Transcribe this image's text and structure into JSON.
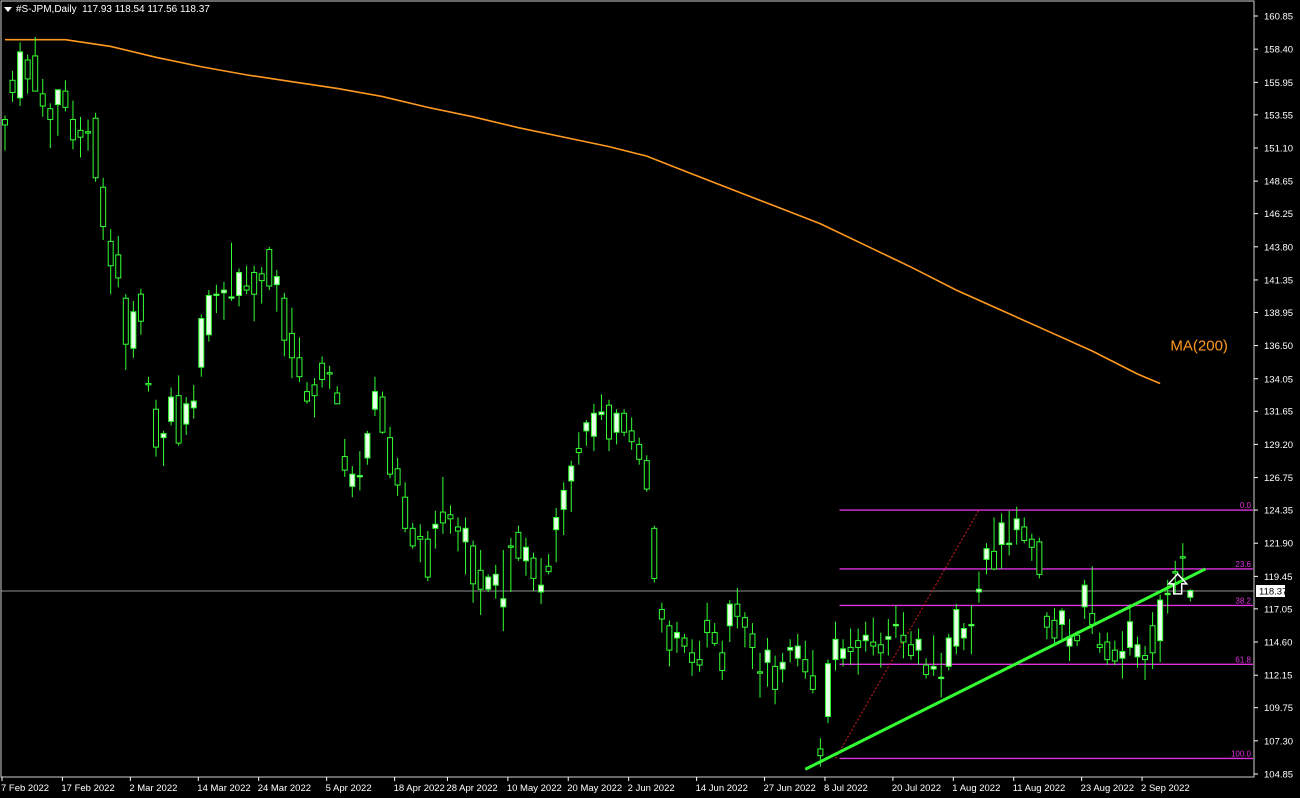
{
  "header": {
    "symbol": "#S-JPM,Daily",
    "ohlc": "117.93 118.54 117.56 118.37"
  },
  "colors": {
    "background": "#000000",
    "candle_up": "#e8ffe8",
    "candle_down": "#000000",
    "wick": "#33ff33",
    "ma": "#ff9a1e",
    "fib": "#e030e0",
    "trendline": "#33ff33",
    "price_line": "#c0c0c0",
    "axis": "#ffffff",
    "arrow": "#ffffff"
  },
  "chart_data": {
    "type": "candlestick",
    "symbol": "#S-JPM",
    "timeframe": "Daily",
    "ylim": [
      104.85,
      160.85
    ],
    "y_ticks": [
      "160.85",
      "158.40",
      "155.95",
      "153.55",
      "151.10",
      "148.65",
      "146.25",
      "143.80",
      "141.35",
      "138.95",
      "136.50",
      "134.05",
      "131.65",
      "129.20",
      "126.75",
      "124.35",
      "121.90",
      "119.45",
      "117.05",
      "114.60",
      "112.15",
      "109.75",
      "107.30",
      "104.85"
    ],
    "x_ticks": [
      "7 Feb 2022",
      "17 Feb 2022",
      "2 Mar 2022",
      "14 Mar 2022",
      "24 Mar 2022",
      "5 Apr 2022",
      "18 Apr 2022",
      "28 Apr 2022",
      "10 May 2022",
      "20 May 2022",
      "2 Jun 2022",
      "14 Jun 2022",
      "27 Jun 2022",
      "8 Jul 2022",
      "20 Jul 2022",
      "1 Aug 2022",
      "11 Aug 2022",
      "23 Aug 2022",
      "2 Sep 2022"
    ],
    "x_tick_index": [
      0,
      8,
      17,
      26,
      34,
      43,
      52,
      59,
      67,
      75,
      83,
      92,
      101,
      109,
      118,
      126,
      134,
      143,
      151
    ],
    "current_price": "118.37",
    "candles": [
      [
        153.2,
        153.5,
        150.9,
        152.8
      ],
      [
        156.1,
        156.8,
        154.5,
        155.2
      ],
      [
        154.8,
        158.9,
        154.2,
        158.2
      ],
      [
        157.6,
        158.0,
        155.1,
        156.2
      ],
      [
        157.9,
        159.3,
        155.5,
        155.3
      ],
      [
        155.1,
        156.2,
        153.4,
        154.2
      ],
      [
        154.0,
        154.4,
        151.1,
        153.2
      ],
      [
        154.3,
        155.2,
        152.0,
        155.4
      ],
      [
        155.3,
        156.1,
        153.8,
        154.1
      ],
      [
        153.2,
        154.6,
        151.0,
        151.7
      ],
      [
        152.4,
        153.4,
        150.4,
        151.9
      ],
      [
        152.3,
        153.2,
        150.9,
        152.2
      ],
      [
        153.3,
        153.7,
        148.6,
        148.9
      ],
      [
        148.2,
        148.9,
        144.3,
        145.3
      ],
      [
        144.2,
        145.1,
        140.3,
        142.4
      ],
      [
        143.2,
        144.6,
        140.8,
        141.5
      ],
      [
        140.0,
        140.3,
        134.7,
        136.6
      ],
      [
        136.3,
        139.8,
        135.6,
        139.0
      ],
      [
        140.3,
        140.7,
        137.3,
        138.3
      ],
      [
        133.7,
        134.2,
        133.1,
        133.6
      ],
      [
        131.8,
        132.5,
        128.3,
        129.0
      ],
      [
        129.7,
        130.2,
        127.6,
        130.0
      ],
      [
        130.9,
        133.4,
        130.6,
        132.7
      ],
      [
        132.8,
        134.3,
        129.1,
        129.3
      ],
      [
        130.7,
        132.7,
        129.9,
        132.2
      ],
      [
        131.9,
        133.6,
        131.1,
        132.4
      ],
      [
        134.9,
        138.8,
        134.2,
        138.5
      ],
      [
        137.3,
        140.6,
        136.8,
        140.2
      ],
      [
        140.2,
        141.0,
        138.9,
        140.3
      ],
      [
        140.4,
        141.2,
        138.4,
        140.6
      ],
      [
        140.0,
        144.1,
        139.8,
        140.1
      ],
      [
        140.2,
        142.2,
        139.4,
        141.9
      ],
      [
        140.9,
        142.4,
        140.3,
        140.6
      ],
      [
        141.9,
        142.4,
        138.3,
        140.3
      ],
      [
        141.8,
        142.3,
        139.6,
        141.3
      ],
      [
        143.6,
        143.8,
        140.6,
        140.9
      ],
      [
        141.0,
        142.1,
        139.0,
        141.6
      ],
      [
        140.0,
        140.4,
        135.7,
        136.9
      ],
      [
        137.4,
        139.3,
        134.1,
        135.6
      ],
      [
        135.6,
        137.1,
        133.8,
        134.2
      ],
      [
        133.1,
        133.8,
        132.2,
        132.4
      ],
      [
        133.6,
        134.1,
        131.2,
        132.8
      ],
      [
        135.2,
        135.7,
        133.4,
        134.0
      ],
      [
        134.5,
        135.0,
        133.3,
        134.4
      ],
      [
        133.0,
        133.5,
        132.2,
        132.2
      ],
      [
        128.3,
        129.6,
        126.8,
        127.3
      ],
      [
        126.1,
        127.6,
        125.3,
        127.0
      ],
      [
        126.8,
        128.7,
        125.8,
        126.9
      ],
      [
        128.2,
        130.2,
        127.7,
        130.0
      ],
      [
        131.8,
        134.2,
        131.3,
        133.1
      ],
      [
        132.7,
        133.1,
        130.0,
        130.1
      ],
      [
        129.7,
        130.5,
        126.7,
        127.0
      ],
      [
        127.4,
        128.2,
        125.4,
        126.2
      ],
      [
        125.3,
        126.4,
        122.7,
        123.0
      ],
      [
        123.0,
        123.4,
        121.5,
        121.7
      ],
      [
        122.4,
        123.3,
        120.5,
        122.2
      ],
      [
        122.2,
        122.8,
        119.1,
        119.4
      ],
      [
        123.0,
        124.3,
        121.5,
        123.3
      ],
      [
        124.2,
        126.8,
        122.6,
        123.4
      ],
      [
        124.0,
        124.7,
        122.6,
        123.7
      ],
      [
        123.1,
        123.8,
        121.3,
        122.8
      ],
      [
        122.0,
        123.8,
        119.6,
        123.0
      ],
      [
        121.7,
        122.1,
        117.5,
        118.9
      ],
      [
        119.9,
        121.4,
        116.6,
        118.5
      ],
      [
        118.5,
        119.6,
        118.3,
        119.4
      ],
      [
        118.8,
        120.3,
        117.8,
        119.6
      ],
      [
        117.2,
        121.4,
        115.4,
        117.8
      ],
      [
        121.7,
        122.3,
        118.3,
        121.6
      ],
      [
        122.7,
        123.2,
        120.6,
        120.8
      ],
      [
        120.6,
        122.3,
        119.5,
        121.6
      ],
      [
        120.8,
        121.2,
        118.4,
        119.3
      ],
      [
        118.3,
        120.8,
        117.4,
        118.8
      ],
      [
        120.2,
        121.1,
        119.6,
        119.8
      ],
      [
        122.9,
        124.5,
        120.5,
        123.8
      ],
      [
        124.4,
        126.4,
        122.5,
        125.8
      ],
      [
        126.5,
        128.0,
        124.2,
        127.6
      ],
      [
        128.9,
        130.1,
        127.7,
        128.6
      ],
      [
        130.2,
        131.0,
        129.1,
        130.8
      ],
      [
        129.8,
        132.2,
        128.7,
        131.5
      ],
      [
        131.4,
        132.9,
        131.0,
        131.6
      ],
      [
        132.1,
        132.5,
        128.7,
        129.6
      ],
      [
        130.1,
        131.8,
        129.2,
        131.5
      ],
      [
        131.5,
        131.8,
        129.8,
        130.1
      ],
      [
        130.2,
        131.2,
        128.8,
        129.4
      ],
      [
        129.2,
        129.7,
        127.7,
        128.1
      ],
      [
        128.0,
        128.4,
        125.7,
        125.9
      ],
      [
        123.0,
        123.2,
        119.0,
        119.3
      ],
      [
        117.0,
        117.5,
        115.3,
        116.3
      ],
      [
        115.8,
        116.2,
        112.8,
        114.0
      ],
      [
        114.9,
        116.1,
        113.8,
        115.3
      ],
      [
        114.9,
        115.2,
        113.8,
        114.3
      ],
      [
        113.8,
        114.8,
        112.1,
        113.1
      ],
      [
        113.3,
        114.7,
        112.4,
        112.9
      ],
      [
        116.2,
        117.5,
        114.2,
        115.3
      ],
      [
        115.3,
        116.0,
        114.3,
        114.5
      ],
      [
        113.8,
        114.7,
        111.8,
        112.5
      ],
      [
        115.8,
        117.7,
        114.6,
        117.4
      ],
      [
        117.4,
        118.6,
        115.6,
        116.5
      ],
      [
        116.4,
        116.8,
        114.2,
        115.7
      ],
      [
        115.2,
        116.0,
        112.6,
        114.2
      ],
      [
        112.4,
        113.8,
        110.5,
        112.3
      ],
      [
        113.1,
        114.9,
        111.3,
        114.0
      ],
      [
        112.8,
        113.6,
        110.0,
        111.1
      ],
      [
        112.6,
        113.8,
        111.6,
        113.1
      ],
      [
        114.0,
        114.8,
        113.1,
        114.2
      ],
      [
        113.4,
        115.2,
        112.8,
        114.3
      ],
      [
        113.3,
        114.7,
        111.9,
        112.4
      ],
      [
        112.1,
        114.0,
        110.8,
        111.1
      ],
      [
        106.7,
        107.5,
        105.4,
        106.2
      ],
      [
        109.1,
        113.3,
        108.6,
        113.0
      ],
      [
        113.3,
        116.1,
        112.5,
        114.8
      ],
      [
        113.4,
        114.8,
        112.8,
        114.1
      ],
      [
        114.2,
        115.6,
        112.9,
        113.9
      ],
      [
        114.7,
        115.6,
        112.2,
        114.2
      ],
      [
        114.7,
        116.1,
        113.9,
        115.1
      ],
      [
        114.6,
        116.4,
        113.6,
        114.3
      ],
      [
        114.4,
        115.3,
        112.7,
        113.8
      ],
      [
        114.8,
        116.3,
        113.6,
        115.0
      ],
      [
        115.8,
        117.3,
        114.9,
        115.9
      ],
      [
        115.1,
        116.8,
        113.4,
        114.6
      ],
      [
        114.4,
        115.4,
        113.3,
        113.6
      ],
      [
        114.0,
        115.6,
        112.9,
        114.8
      ],
      [
        112.9,
        113.4,
        111.9,
        112.2
      ],
      [
        112.6,
        115.1,
        112.1,
        112.8
      ],
      [
        111.9,
        113.8,
        110.5,
        112.0
      ],
      [
        112.8,
        115.2,
        112.5,
        114.9
      ],
      [
        114.3,
        117.4,
        113.7,
        117.0
      ],
      [
        114.9,
        116.0,
        114.0,
        115.6
      ],
      [
        115.8,
        117.3,
        113.7,
        115.9
      ],
      [
        118.3,
        119.8,
        117.5,
        118.5
      ],
      [
        120.7,
        121.9,
        119.6,
        121.5
      ],
      [
        121.3,
        123.8,
        119.9,
        120.0
      ],
      [
        121.8,
        124.1,
        120.0,
        123.4
      ],
      [
        121.8,
        124.3,
        121.0,
        121.9
      ],
      [
        122.9,
        124.6,
        121.8,
        123.7
      ],
      [
        123.1,
        123.8,
        121.9,
        122.1
      ],
      [
        122.2,
        122.6,
        120.6,
        121.6
      ],
      [
        122.0,
        122.3,
        119.3,
        119.6
      ],
      [
        116.5,
        116.8,
        114.8,
        115.7
      ],
      [
        116.2,
        117.1,
        114.5,
        114.9
      ],
      [
        115.9,
        117.1,
        114.8,
        116.9
      ],
      [
        114.3,
        116.3,
        113.2,
        115.0
      ],
      [
        115.1,
        115.4,
        114.3,
        114.7
      ],
      [
        117.2,
        119.2,
        116.3,
        118.8
      ],
      [
        116.7,
        120.2,
        115.2,
        115.9
      ],
      [
        114.4,
        115.3,
        113.8,
        114.2
      ],
      [
        114.6,
        115.3,
        112.9,
        113.3
      ],
      [
        114.0,
        114.7,
        112.9,
        113.2
      ],
      [
        113.4,
        115.4,
        111.9,
        113.9
      ],
      [
        114.2,
        117.4,
        113.6,
        116.1
      ],
      [
        113.5,
        115.0,
        112.7,
        114.4
      ],
      [
        113.6,
        114.3,
        111.8,
        113.3
      ],
      [
        115.8,
        116.8,
        112.6,
        113.8
      ],
      [
        114.7,
        118.1,
        113.1,
        117.7
      ],
      [
        118.1,
        119.2,
        116.7,
        118.2
      ],
      [
        119.8,
        120.6,
        118.1,
        119.7
      ],
      [
        120.9,
        121.9,
        119.1,
        120.8
      ],
      [
        117.9,
        118.5,
        117.6,
        118.4
      ]
    ],
    "ma": {
      "name": "MA(200)",
      "values": [
        [
          0,
          159.1
        ],
        [
          8,
          159.1
        ],
        [
          14,
          158.6
        ],
        [
          20,
          157.8
        ],
        [
          26,
          157.1
        ],
        [
          32,
          156.5
        ],
        [
          38,
          156.0
        ],
        [
          44,
          155.5
        ],
        [
          50,
          154.9
        ],
        [
          56,
          154.1
        ],
        [
          62,
          153.4
        ],
        [
          68,
          152.6
        ],
        [
          74,
          151.9
        ],
        [
          80,
          151.2
        ],
        [
          85,
          150.5
        ],
        [
          90,
          149.4
        ],
        [
          96,
          148.1
        ],
        [
          102,
          146.8
        ],
        [
          108,
          145.5
        ],
        [
          114,
          143.9
        ],
        [
          120,
          142.3
        ],
        [
          126,
          140.6
        ],
        [
          132,
          139.1
        ],
        [
          138,
          137.6
        ],
        [
          144,
          136.1
        ],
        [
          150,
          134.4
        ],
        [
          153,
          133.7
        ]
      ]
    },
    "fibonacci": {
      "levels": [
        {
          "label": "0.0",
          "value": 124.35
        },
        {
          "label": "23.6",
          "value": 120.0
        },
        {
          "label": "38.2",
          "value": 117.3
        },
        {
          "label": "61.8",
          "value": 112.95
        },
        {
          "label": "100.0",
          "value": 106.0
        }
      ],
      "start_index": 110,
      "end_index": 159
    },
    "fib_anchor": {
      "from_index": 110,
      "from_value": 106.0,
      "to_index": 129,
      "to_value": 124.35
    },
    "trendline": {
      "from_index": 106,
      "from_value": 105.2,
      "to_index": 159,
      "to_value": 120.0
    },
    "arrow_index": 154,
    "arrow_value": 118.9,
    "ma_label": {
      "text": "MA(200)",
      "index": 148,
      "value": 136.5
    }
  }
}
